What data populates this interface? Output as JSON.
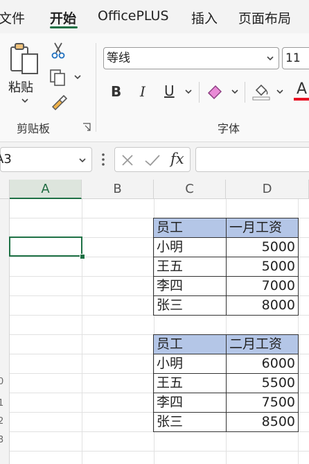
{
  "ribbon_tabs": [
    {
      "label": "文件",
      "active": false
    },
    {
      "label": "开始",
      "active": true
    },
    {
      "label": "OfficePLUS",
      "active": false
    },
    {
      "label": "插入",
      "active": false
    },
    {
      "label": "页面布局",
      "active": false
    }
  ],
  "clipboard": {
    "paste_label": "粘贴",
    "group_label": "剪贴板"
  },
  "font": {
    "font_name": "等线",
    "font_size": "11",
    "bold": "B",
    "italic": "I",
    "underline": "U",
    "font_color_glyph": "A",
    "group_label": "字体"
  },
  "formula_bar": {
    "name_box": "A3",
    "fx_label": "fx",
    "formula": ""
  },
  "columns": [
    "A",
    "B",
    "C",
    "D"
  ],
  "row_numbers": [
    "0",
    "1",
    "2",
    "3"
  ],
  "tables": [
    {
      "headers": [
        "员工",
        "一月工资"
      ],
      "rows": [
        [
          "小明",
          "5000"
        ],
        [
          "王五",
          "5000"
        ],
        [
          "李四",
          "7000"
        ],
        [
          "张三",
          "8000"
        ]
      ]
    },
    {
      "headers": [
        "员工",
        "二月工资"
      ],
      "rows": [
        [
          "小明",
          "6000"
        ],
        [
          "王五",
          "5500"
        ],
        [
          "李四",
          "7500"
        ],
        [
          "张三",
          "8500"
        ]
      ]
    }
  ],
  "colors": {
    "accent": "#1e7145",
    "table_header": "#b4c6e7",
    "font_color_bar": "#e81123"
  }
}
